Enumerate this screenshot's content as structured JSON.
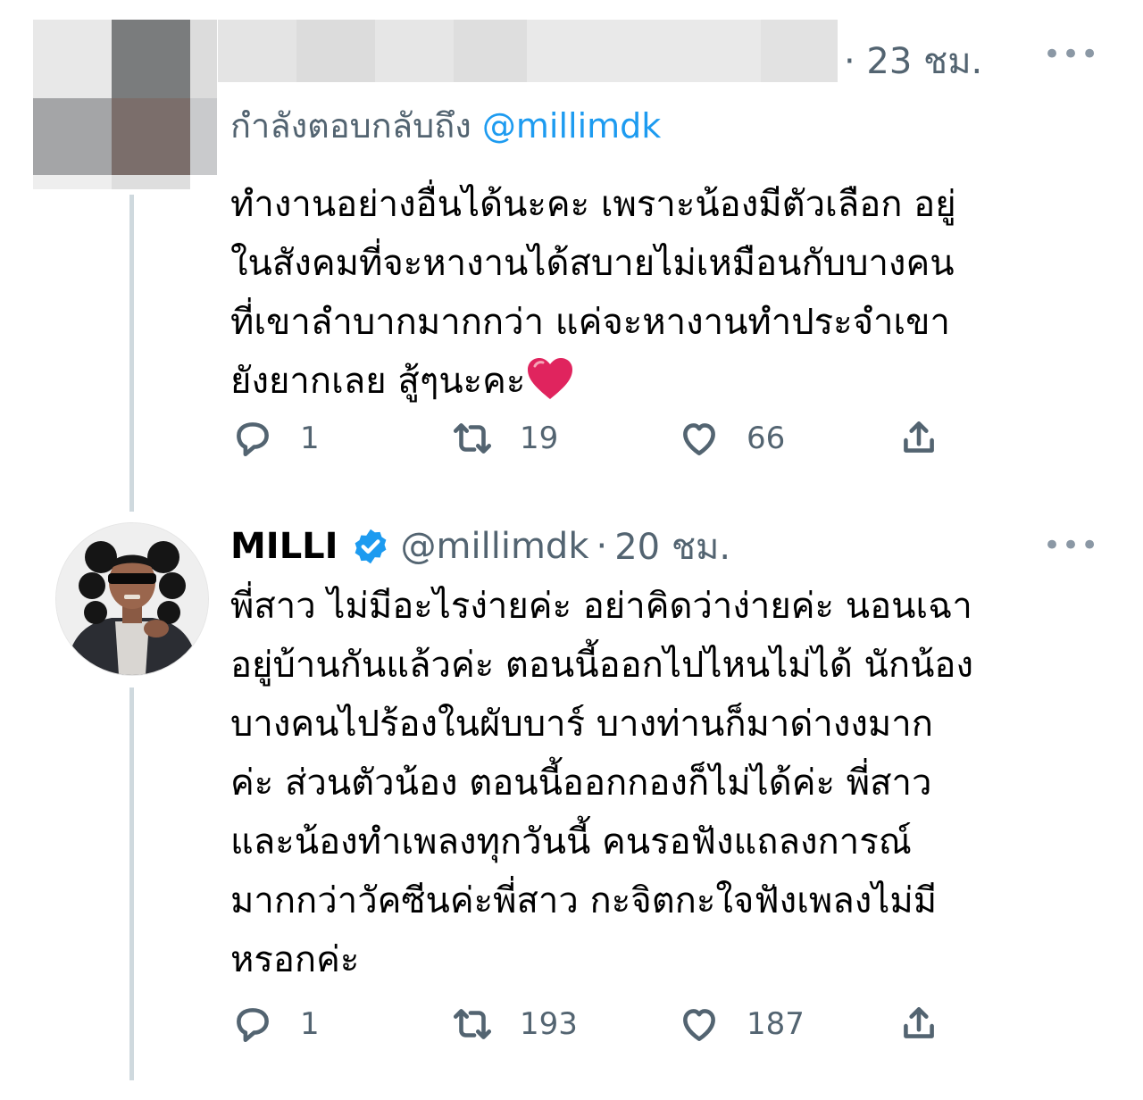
{
  "tweets": [
    {
      "time": "· 23 ชม.",
      "more_label": "•••",
      "reply_prefix": "กำลังตอบกลับถึง ",
      "reply_mention": "@millimdk",
      "text": "ทำงานอย่างอื่นได้นะคะ เพราะน้องมีตัวเลือก อยู่\nในสังคมที่จะหางานได้สบายไม่เหมือนกับบางคน\nที่เขาลำบากมากกว่า แค่จะหางานทำประจำเขา\nยังยากเลย สู้ๆนะคะ",
      "emoji": "red-heart",
      "replies": "1",
      "retweets": "19",
      "likes": "66"
    },
    {
      "display_name": "MILLI",
      "handle": "@millimdk",
      "separator": "·",
      "time": "20 ชม.",
      "more_label": "•••",
      "text": "พี่สาว ไม่มีอะไรง่ายค่ะ อย่าคิดว่าง่ายค่ะ นอนเฉา\nอยู่บ้านกันแล้วค่ะ ตอนนี้ออกไปไหนไม่ได้ นักน้อง\nบางคนไปร้องในผับบาร์ บางท่านก็มาด่างงมาก\nค่ะ ส่วนตัวน้อง ตอนนี้ออกกองก็ไม่ได้ค่ะ พี่สาว\nและน้องทำเพลงทุกวันนี้ คนรอฟังแถลงการณ์\nมากกว่าวัคซีนค่ะพี่สาว กะจิตกะใจฟังเพลงไม่มี\nหรอกค่ะ",
      "replies": "1",
      "retweets": "193",
      "likes": "187"
    }
  ],
  "icons": [
    "reply-icon",
    "retweet-icon",
    "like-icon",
    "share-icon",
    "verified-badge-icon"
  ],
  "colors": {
    "accent": "#1d9bf0",
    "muted": "#536471",
    "thread_line": "#cfd9de",
    "heart": "#e0245e"
  }
}
